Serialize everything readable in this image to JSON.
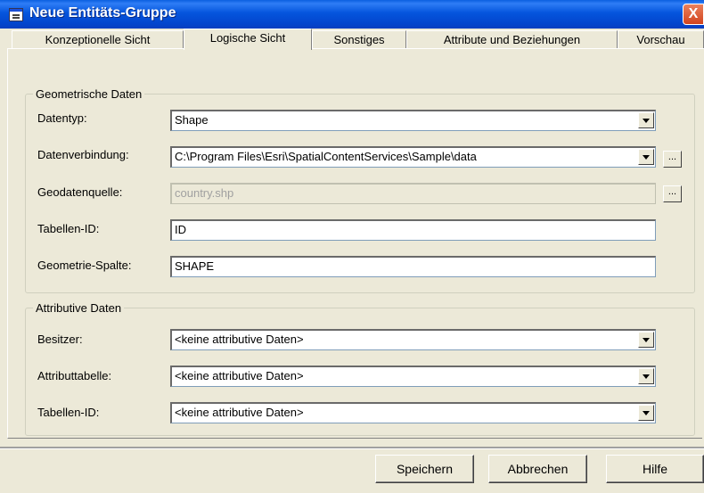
{
  "window": {
    "title": "Neue Entitäts-Gruppe",
    "close_glyph": "X"
  },
  "tabs": [
    {
      "label": "Konzeptionelle Sicht",
      "active": false
    },
    {
      "label": "Logische Sicht",
      "active": true
    },
    {
      "label": "Sonstiges",
      "active": false
    },
    {
      "label": "Attribute und Beziehungen",
      "active": false
    },
    {
      "label": "Vorschau",
      "active": false
    }
  ],
  "geometric": {
    "title": "Geometrische Daten",
    "datentyp": {
      "label": "Datentyp:",
      "value": "Shape"
    },
    "datenverbindung": {
      "label": "Datenverbindung:",
      "value": "C:\\Program Files\\Esri\\SpatialContentServices\\Sample\\data"
    },
    "geodatenquelle": {
      "label": "Geodatenquelle:",
      "value": "country.shp"
    },
    "tabellen_id": {
      "label": "Tabellen-ID:",
      "value": "ID"
    },
    "geometrie_spalte": {
      "label": "Geometrie-Spalte:",
      "value": "SHAPE"
    },
    "browse_label": "..."
  },
  "attributive": {
    "title": "Attributive Daten",
    "besitzer": {
      "label": "Besitzer:",
      "value": "<keine attributive Daten>"
    },
    "attributtabelle": {
      "label": "Attributtabelle:",
      "value": "<keine attributive Daten>"
    },
    "tabellen_id": {
      "label": "Tabellen-ID:",
      "value": "<keine attributive Daten>"
    }
  },
  "buttons": {
    "save": "Speichern",
    "cancel": "Abbrechen",
    "help": "Hilfe"
  },
  "colors": {
    "titlebar": "#0555dd",
    "close": "#d2441e",
    "face": "#ece9d8"
  }
}
